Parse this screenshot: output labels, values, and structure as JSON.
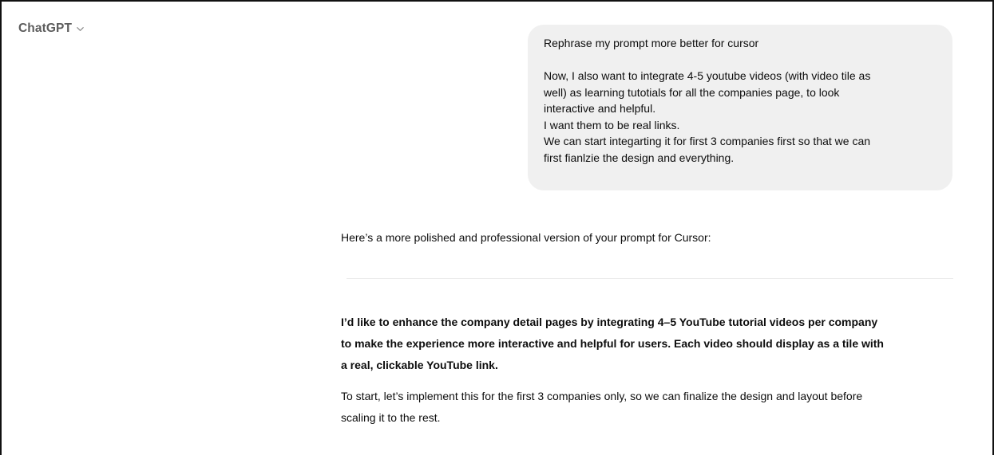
{
  "header": {
    "model_name": "ChatGPT",
    "model_menu_icon": "chevron-down-icon"
  },
  "user_message": {
    "lines": [
      "Rephrase my prompt more better for cursor",
      "",
      "Now, I also want to integrate 4-5 youtube videos (with video tile as",
      "well) as learning tutotials for all the companies page, to look",
      "interactive and helpful.",
      "I want them to be real links.",
      "We can start integarting it for first 3 companies first so that we can",
      "first fianlzie the design and everything."
    ]
  },
  "assistant_message": {
    "intro": "Here’s a more polished and professional version of your prompt for Cursor:",
    "bold_lines": [
      "I’d like to enhance the company detail pages by integrating 4–5 YouTube tutorial videos per company",
      "to make the experience more interactive and helpful for users. Each video should display as a tile with",
      "a real, clickable YouTube link."
    ],
    "plain_lines": [
      "To start, let’s implement this for the first 3 companies only, so we can finalize the design and layout before",
      "scaling it to the rest."
    ]
  },
  "colors": {
    "bubble_background": "#f0f0f0",
    "text": "#0d0d0d",
    "muted": "#5d5d5d",
    "divider": "#ececec"
  }
}
